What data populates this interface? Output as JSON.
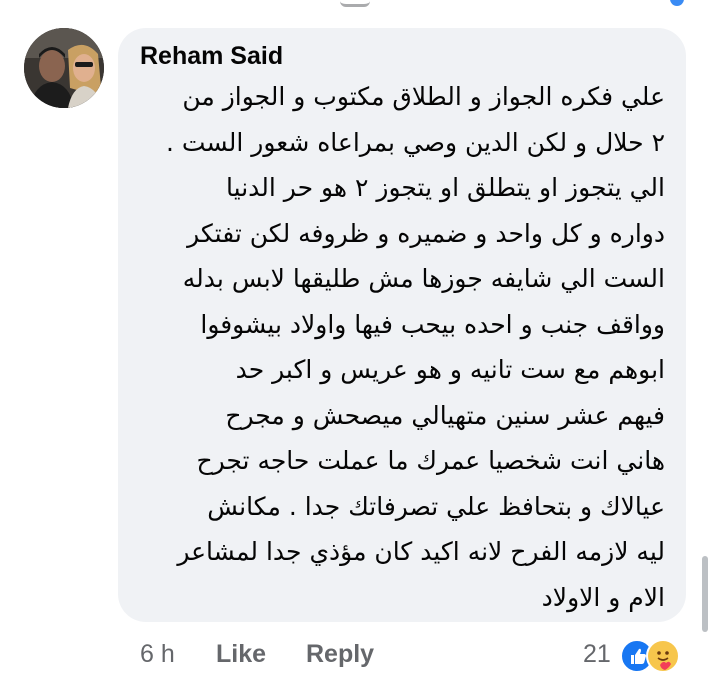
{
  "comment": {
    "author": "Reham Said",
    "lines": [
      "علي فكره الجواز و الطلاق مكتوب و الجواز من",
      "٢ حلال و لكن الدين وصي بمراعاه شعور الست .",
      "الي يتجوز او يتطلق او يتجوز ٢ هو حر الدنيا",
      "دواره و كل واحد و ضميره و ظروفه لكن تفتكر",
      "الست الي شايفه جوزها مش طليقها لابس بدله",
      "وواقف جنب و احده بيحب فيها واولاد بيشوفوا",
      "ابوهم مع ست تانيه و هو عريس و اكبر حد",
      "فيهم عشر سنين متهيالي ميصحش و مجرح",
      "هاني انت شخصيا عمرك ما عملت حاجه تجرح",
      "عيالاك و بتحافظ علي تصرفاتك جدا . مكانش",
      "ليه لازمه الفرح لانه اكيد كان مؤذي جدا لمشاعر",
      "الام و الاولاد"
    ]
  },
  "footer": {
    "time": "6 h",
    "like_label": "Like",
    "reply_label": "Reply",
    "reaction_count": "21"
  },
  "reactions": [
    "like-reaction-icon",
    "care-reaction-icon"
  ],
  "colors": {
    "bubble": "#f0f2f5",
    "text": "#050505",
    "secondary": "#65676b",
    "like_blue": "#1877f2",
    "care_yellow": "#f7c64c"
  }
}
